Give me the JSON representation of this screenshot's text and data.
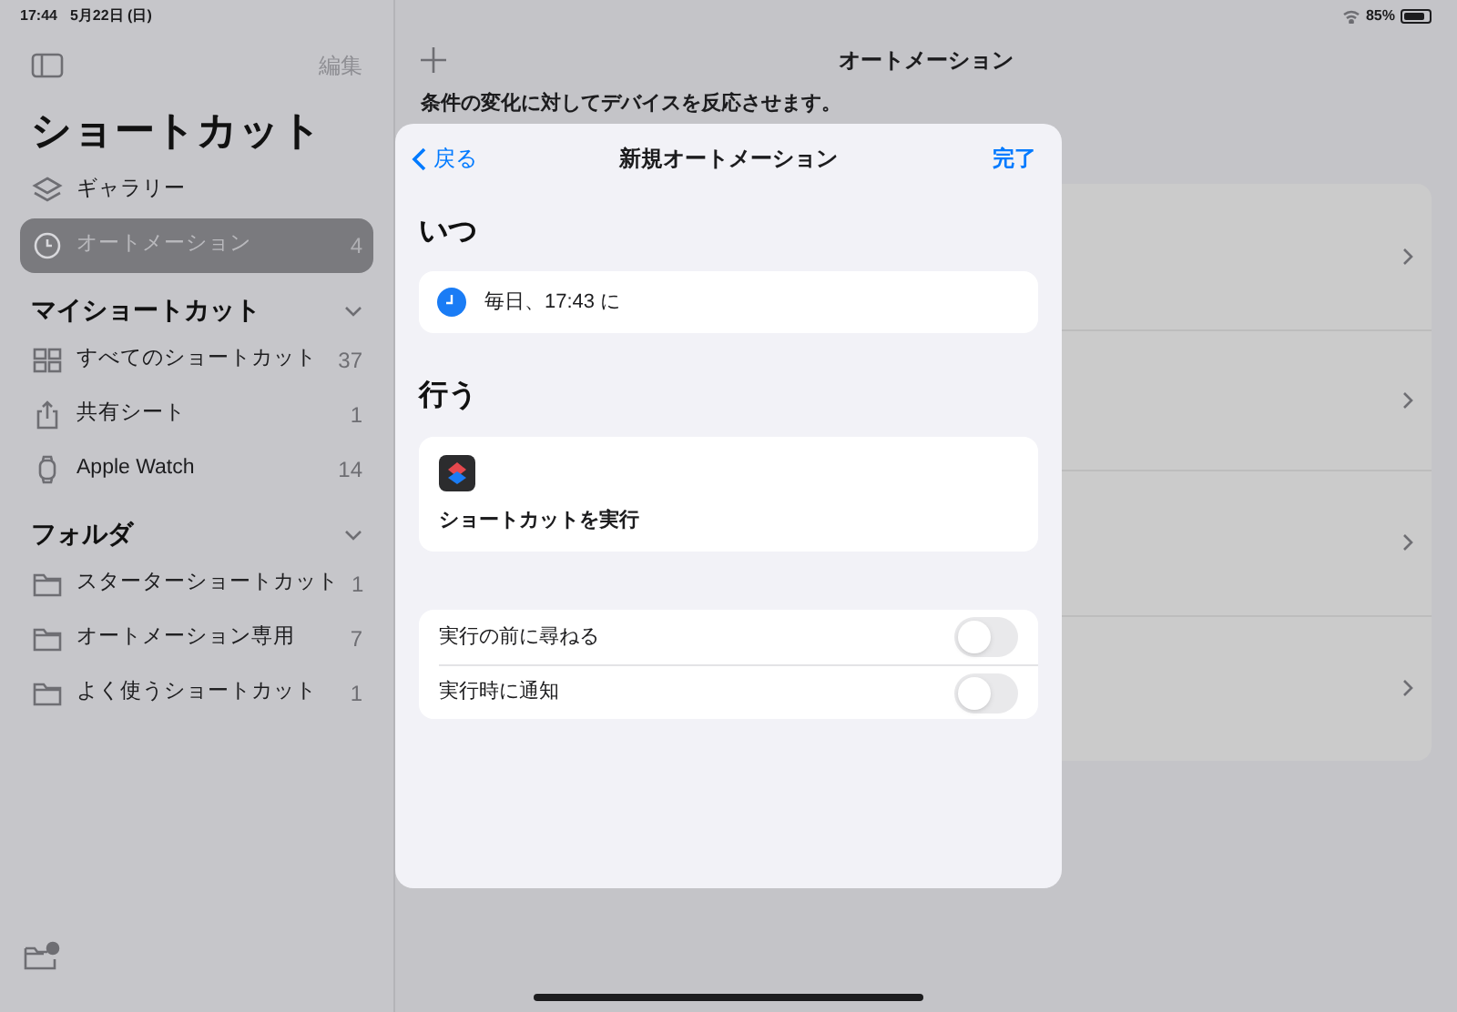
{
  "status_bar": {
    "time": "17:44",
    "date": "5月22日 (日)",
    "battery": "85%"
  },
  "sidebar": {
    "edit": "編集",
    "title": "ショートカット",
    "items": [
      {
        "kind": "gallery",
        "label": "ギャラリー",
        "selected": false
      },
      {
        "kind": "automation",
        "label": "オートメーション",
        "count": "4",
        "selected": true
      }
    ],
    "sections": [
      {
        "title": "マイショートカット",
        "items": [
          {
            "kind": "grid",
            "label": "すべてのショートカット",
            "count": "37",
            "selected": false
          },
          {
            "kind": "share",
            "label": "共有シート",
            "count": "1",
            "selected": false
          },
          {
            "kind": "watch",
            "label": "Apple Watch",
            "count": "14",
            "selected": false
          }
        ]
      },
      {
        "title": "フォルダ",
        "items": [
          {
            "kind": "folder",
            "label": "スターターショートカット",
            "count": "1",
            "selected": false
          },
          {
            "kind": "folder",
            "label": "オートメーション専用",
            "count": "7",
            "selected": false
          },
          {
            "kind": "folder",
            "label": "よく使うショートカット",
            "count": "1",
            "selected": false
          }
        ]
      }
    ]
  },
  "main": {
    "title": "オートメーション",
    "description": "条件の変化に対してデバイスを反応させます。"
  },
  "sheet": {
    "back": "戻る",
    "title": "新規オートメーション",
    "done": "完了",
    "when": {
      "heading": "いつ",
      "trigger": "毎日、17:43 に"
    },
    "do": {
      "heading": "行う",
      "action": "ショートカットを実行"
    },
    "options": [
      {
        "label": "実行の前に尋ねる",
        "on": false
      },
      {
        "label": "実行時に通知",
        "on": false
      }
    ]
  }
}
